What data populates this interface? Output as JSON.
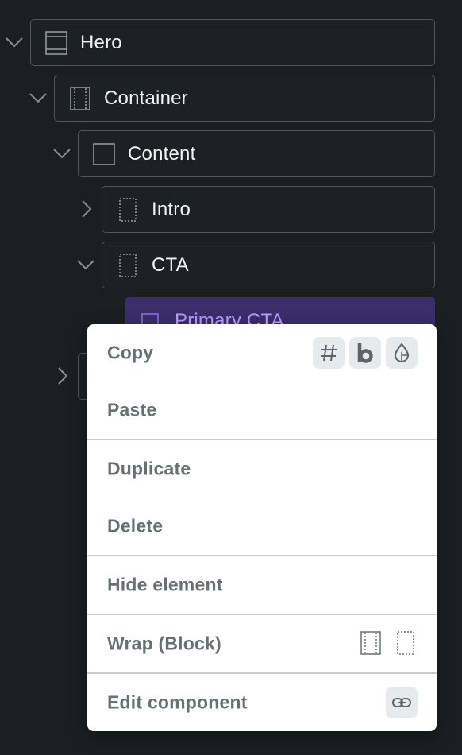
{
  "tree": {
    "items": [
      {
        "label": "Hero",
        "icon": "section-icon",
        "expanded": true
      },
      {
        "label": "Container",
        "icon": "container-icon",
        "expanded": true
      },
      {
        "label": "Content",
        "icon": "block-icon",
        "expanded": true
      },
      {
        "label": "Intro",
        "icon": "div-icon",
        "expanded": false
      },
      {
        "label": "CTA",
        "icon": "div-icon",
        "expanded": true
      },
      {
        "label": "Primary CTA",
        "icon": "block-icon",
        "selected": true
      }
    ]
  },
  "context_menu": {
    "items": [
      {
        "label": "Copy",
        "actions": [
          "hash-icon",
          "bold-b-icon",
          "color-drop-icon"
        ]
      },
      {
        "label": "Paste"
      },
      {
        "label": "Duplicate"
      },
      {
        "label": "Delete"
      },
      {
        "label": "Hide element"
      },
      {
        "label": "Wrap (Block)",
        "actions": [
          "wrap-block-icon",
          "wrap-div-icon"
        ]
      },
      {
        "label": "Edit component",
        "actions": [
          "link-icon"
        ]
      }
    ]
  },
  "colors": {
    "background": "#1b1e23",
    "selected_bg": "#3c2d6b",
    "selected_text": "#b49cff",
    "menu_text": "#6b6e73"
  }
}
